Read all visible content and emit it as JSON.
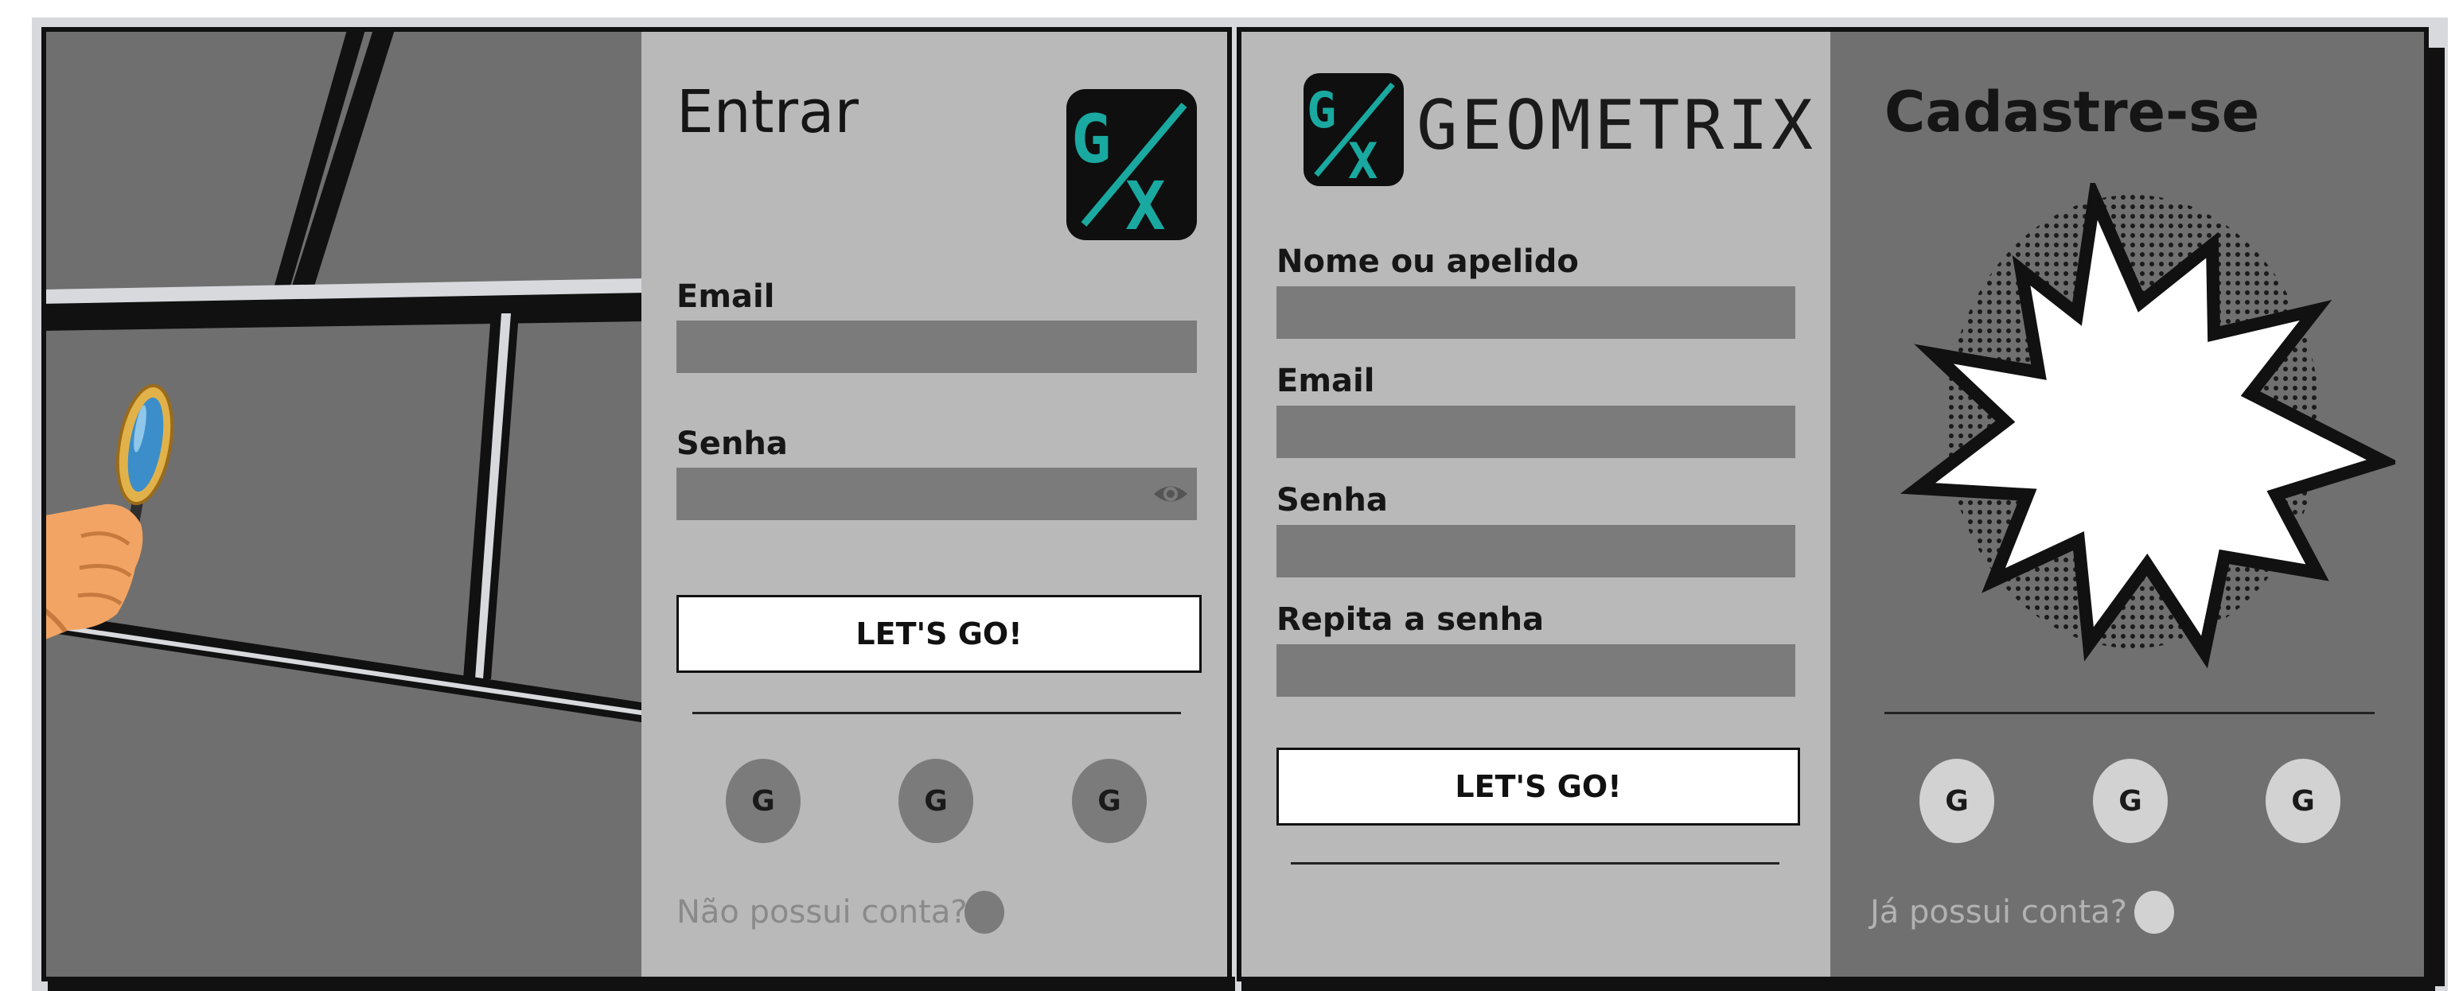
{
  "login": {
    "title": "Entrar",
    "logo_text": "G/X",
    "email_label": "Email",
    "password_label": "Senha",
    "submit_label": "LET'S GO!",
    "social": [
      {
        "label": "G"
      },
      {
        "label": "G"
      },
      {
        "label": "G"
      }
    ],
    "no_account_text": "Não possui conta?"
  },
  "register": {
    "brand_name": "GEOMETRIX",
    "logo_text": "G/X",
    "name_label": "Nome ou apelido",
    "email_label": "Email",
    "password_label": "Senha",
    "repeat_password_label": "Repita a senha",
    "submit_label": "LET'S GO!",
    "title": "Cadastre-se",
    "social": [
      {
        "label": "G"
      },
      {
        "label": "G"
      },
      {
        "label": "G"
      }
    ],
    "has_account_text": "Já possui conta?"
  },
  "colors": {
    "panel_light": "#b9b9b9",
    "panel_dark": "#707070",
    "field": "#7b7b7b",
    "logo_accent": "#19a9a0"
  }
}
